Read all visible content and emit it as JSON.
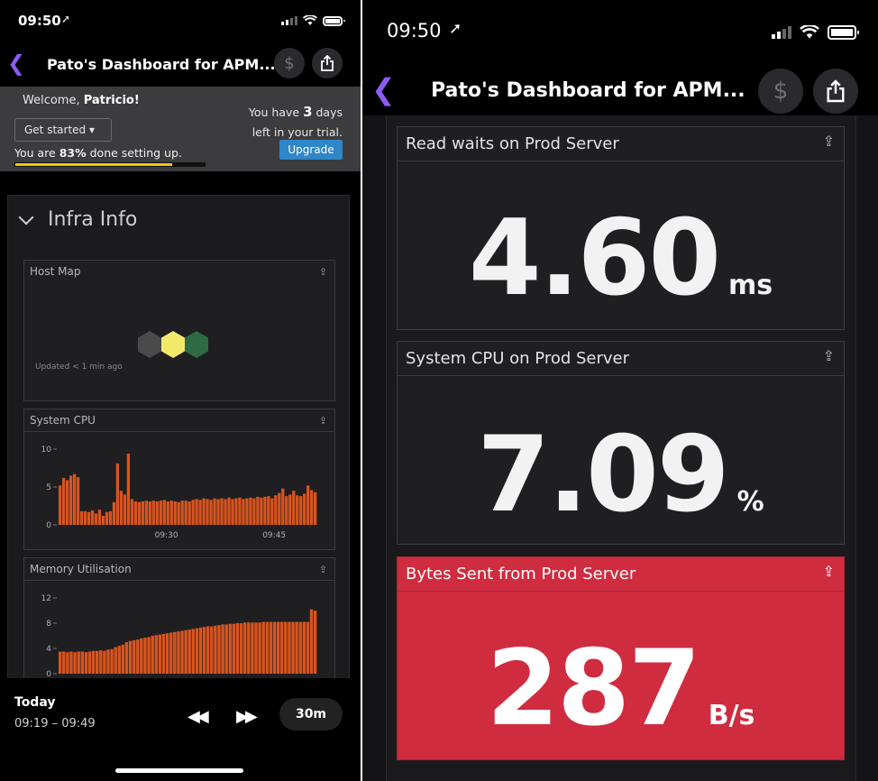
{
  "left": {
    "status": {
      "time": "09:50"
    },
    "nav": {
      "title": "Pato's Dashboard for APM...",
      "back": "<",
      "cost": "$"
    },
    "banner": {
      "welcome_prefix": "Welcome, ",
      "welcome_name": "Patricio!",
      "get_started": "Get started ▾",
      "progress_prefix": "You are ",
      "progress_percent": "83%",
      "progress_suffix": " done setting up.",
      "progress_fraction": 0.83,
      "trial_prefix": "You have ",
      "trial_days": "3",
      "trial_suffix_1": " days",
      "trial_suffix_2": "left in your trial.",
      "upgrade": "Upgrade"
    },
    "group": {
      "title": "Infra Info",
      "host_map": {
        "title": "Host Map",
        "updated": "Updated < 1 min ago",
        "hex_colors": [
          "#4a4a4a",
          "#f2e96b",
          "#2e6b43"
        ]
      },
      "system_cpu": {
        "title": "System CPU",
        "yticks": [
          "10",
          "5",
          "0"
        ],
        "xticks": [
          "09:30",
          "09:45"
        ]
      },
      "memory": {
        "title": "Memory Utilisation",
        "yticks": [
          "12",
          "8",
          "4",
          "0"
        ]
      }
    },
    "footer": {
      "today": "Today",
      "range": "09:19 – 09:49",
      "span": "30m"
    }
  },
  "right": {
    "status": {
      "time": "09:50"
    },
    "nav": {
      "title": "Pato's Dashboard for APM...",
      "cost": "$"
    },
    "widgets": [
      {
        "title": "Read waits on Prod Server",
        "value": "4.60",
        "unit": "ms"
      },
      {
        "title": "System CPU on Prod Server",
        "value": "7.09",
        "unit": "%"
      },
      {
        "title": "Bytes Sent from Prod Server",
        "value": "287",
        "unit": "B/s",
        "alert_color": "#d02c40"
      }
    ]
  },
  "chart_data": [
    {
      "type": "bar",
      "title": "System CPU",
      "ylim": [
        0,
        10
      ],
      "xticks": [
        "09:30",
        "09:45"
      ],
      "color": "#d9541e",
      "values": [
        5.2,
        6.2,
        5.9,
        6.5,
        6.7,
        6.3,
        1.8,
        1.8,
        1.7,
        1.9,
        1.5,
        2.0,
        1.2,
        1.7,
        1.8,
        3.0,
        8.1,
        4.5,
        4.0,
        9.4,
        3.4,
        3.1,
        3.0,
        3.1,
        3.2,
        3.1,
        3.2,
        3.1,
        3.2,
        3.3,
        3.1,
        3.2,
        3.1,
        3.0,
        3.2,
        3.2,
        3.1,
        3.3,
        3.4,
        3.3,
        3.5,
        3.4,
        3.3,
        3.5,
        3.4,
        3.5,
        3.4,
        3.6,
        3.4,
        3.5,
        3.6,
        3.4,
        3.5,
        3.6,
        3.5,
        3.7,
        3.6,
        3.7,
        3.8,
        3.5,
        3.9,
        4.2,
        4.8,
        3.8,
        4.0,
        4.5,
        3.9,
        3.8,
        4.1,
        5.2,
        4.6,
        4.3
      ]
    },
    {
      "type": "bar",
      "title": "Memory Utilisation",
      "ylim": [
        0,
        12
      ],
      "color": "#d9541e",
      "values": [
        3.5,
        3.5,
        3.4,
        3.5,
        3.4,
        3.5,
        3.5,
        3.4,
        3.5,
        3.6,
        3.6,
        3.7,
        3.6,
        3.8,
        3.9,
        4.2,
        4.4,
        4.6,
        5.0,
        5.2,
        5.3,
        5.4,
        5.6,
        5.7,
        5.8,
        6.0,
        6.1,
        6.2,
        6.3,
        6.4,
        6.5,
        6.6,
        6.7,
        6.8,
        6.9,
        7.0,
        7.1,
        7.2,
        7.3,
        7.4,
        7.5,
        7.5,
        7.6,
        7.7,
        7.8,
        7.8,
        7.9,
        7.9,
        8.0,
        8.0,
        8.1,
        8.1,
        8.1,
        8.1,
        8.1,
        8.2,
        8.2,
        8.2,
        8.2,
        8.2,
        8.2,
        8.2,
        8.2,
        8.2,
        8.2,
        8.2,
        8.2,
        8.2,
        10.2,
        10.0
      ]
    }
  ]
}
